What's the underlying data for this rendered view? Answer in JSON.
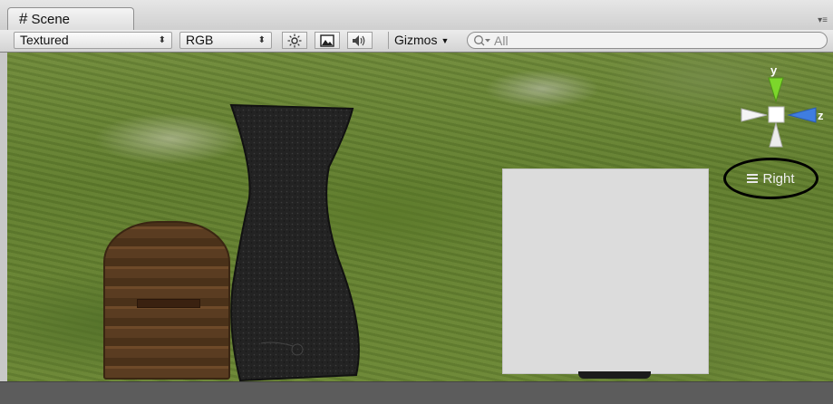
{
  "tab": {
    "icon": "hash-icon",
    "symbol": "#",
    "title": "Scene"
  },
  "toolbar": {
    "render_mode": "Textured",
    "channel": "RGB",
    "lighting_icon": "sun-icon",
    "image_icon": "image-icon",
    "audio_icon": "speaker-icon",
    "gizmos_label": "Gizmos",
    "search": {
      "prefix": "Q",
      "value": "All"
    }
  },
  "gizmo": {
    "y_label": "y",
    "z_label": "z",
    "colors": {
      "y": "#7cd62b",
      "z": "#3f7de0",
      "neutral": "#f0f0f0",
      "center": "#ffffff"
    }
  },
  "view": {
    "label": "Right",
    "menu_icon": "menu-lines-icon"
  }
}
